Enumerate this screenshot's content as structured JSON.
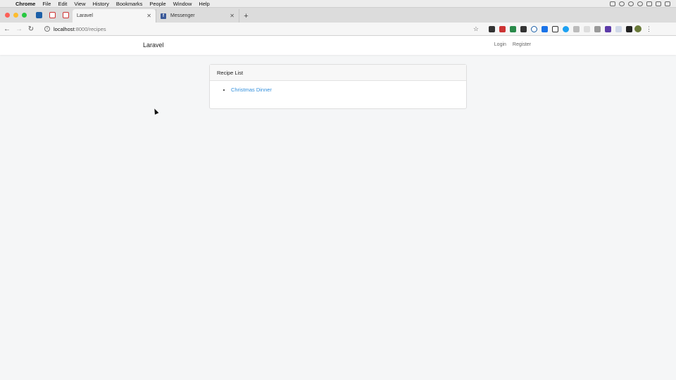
{
  "menubar": {
    "app_name": "Chrome",
    "items": [
      "File",
      "Edit",
      "View",
      "History",
      "Bookmarks",
      "People",
      "Window",
      "Help"
    ]
  },
  "tabs": [
    {
      "title": "Laravel",
      "favicon": "page-icon",
      "active": true
    },
    {
      "title": "Messenger",
      "favicon": "facebook-icon",
      "active": false
    }
  ],
  "toolbar": {
    "url_host": "localhost",
    "url_path": ":8000/recipes"
  },
  "app": {
    "brand": "Laravel",
    "nav": {
      "login": "Login",
      "register": "Register"
    }
  },
  "card": {
    "header": "Recipe List",
    "recipes": [
      {
        "title": "Christmas Dinner"
      }
    ]
  },
  "colors": {
    "link": "#3490dc",
    "page_bg": "#f5f6f7"
  }
}
